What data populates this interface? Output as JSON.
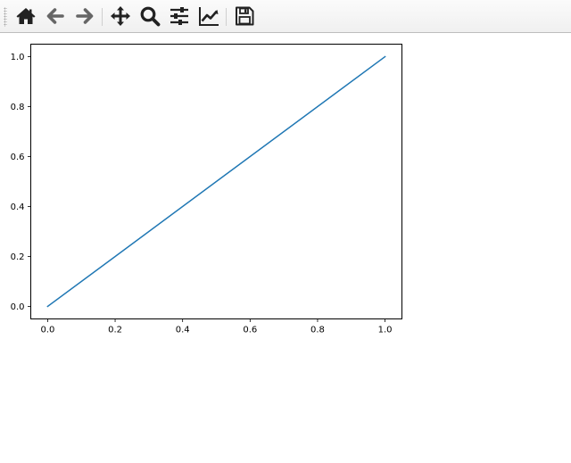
{
  "toolbar": {
    "buttons": [
      {
        "name": "home-button",
        "icon": "home-icon"
      },
      {
        "name": "back-button",
        "icon": "arrow-left-icon"
      },
      {
        "name": "forward-button",
        "icon": "arrow-right-icon"
      },
      {
        "name": "pan-button",
        "icon": "move-icon"
      },
      {
        "name": "zoom-button",
        "icon": "search-icon"
      },
      {
        "name": "configure-subplots-button",
        "icon": "sliders-icon"
      },
      {
        "name": "edit-axis-button",
        "icon": "line-chart-icon"
      },
      {
        "name": "save-button",
        "icon": "floppy-disk-icon"
      }
    ],
    "icon_color": "#222222",
    "disabled_icon_color": "#666666"
  },
  "chart_data": {
    "type": "line",
    "series": [
      {
        "x": [
          0.0,
          1.0
        ],
        "y": [
          0.0,
          1.0
        ],
        "color": "#1f77b4"
      }
    ],
    "xlim": [
      -0.05,
      1.05
    ],
    "ylim": [
      -0.05,
      1.05
    ],
    "xticks": [
      0.0,
      0.2,
      0.4,
      0.6,
      0.8,
      1.0
    ],
    "yticks": [
      0.0,
      0.2,
      0.4,
      0.6,
      0.8,
      1.0
    ],
    "xtick_labels": [
      "0.0",
      "0.2",
      "0.4",
      "0.6",
      "0.8",
      "1.0"
    ],
    "ytick_labels": [
      "0.0",
      "0.2",
      "0.4",
      "0.6",
      "0.8",
      "1.0"
    ],
    "grid": false,
    "title": "",
    "xlabel": "",
    "ylabel": ""
  }
}
